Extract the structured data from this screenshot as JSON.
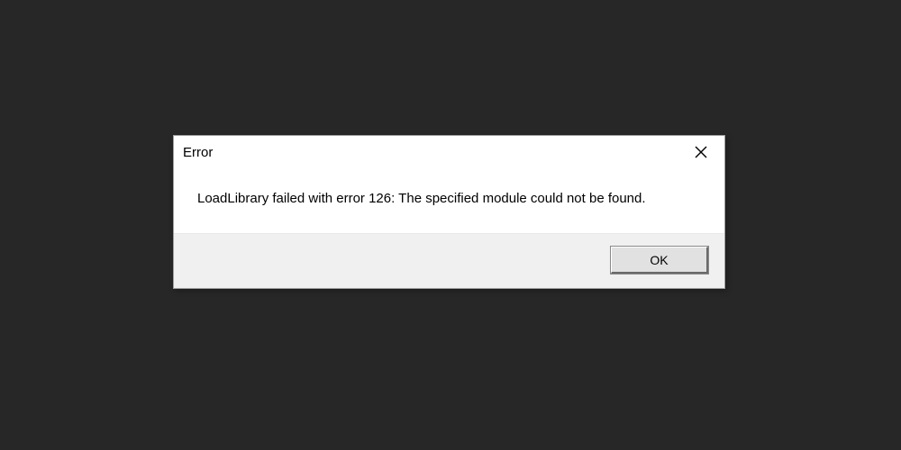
{
  "dialog": {
    "title": "Error",
    "message": "LoadLibrary failed with error 126: The specified module could not be found.",
    "ok_label": "OK"
  }
}
